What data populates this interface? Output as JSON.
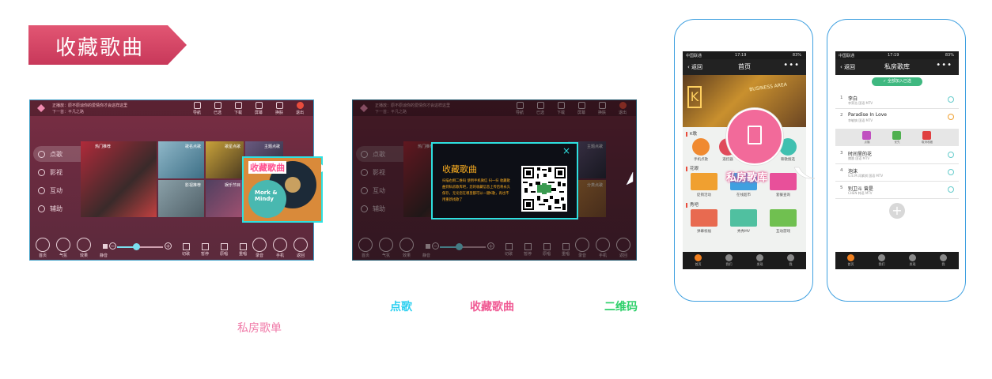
{
  "header": {
    "title": "收藏歌曲"
  },
  "tv": {
    "now_playing": "正播放：原不原谅你的爱情你才会这样这里",
    "next": "下一首：平凡之路",
    "top_icons": [
      {
        "label": "导航",
        "icon": "compass-icon"
      },
      {
        "label": "已选",
        "icon": "list-icon"
      },
      {
        "label": "下载",
        "icon": "download-icon"
      },
      {
        "label": "屏幕",
        "icon": "screen-icon"
      },
      {
        "label": "换肤",
        "icon": "skin-icon"
      },
      {
        "label": "退出",
        "icon": "power-icon"
      }
    ],
    "menu": [
      "点歌",
      "影视",
      "互动",
      "辅助"
    ],
    "tiles": [
      "热门推荐",
      "歌名点歌",
      "歌星点歌",
      "主题点歌",
      "影视推荐",
      "娱乐节目",
      "前线K歌",
      "分类点歌"
    ],
    "bottom_left": [
      "首页",
      "气氛",
      "效果"
    ],
    "volume_label": "静音",
    "volume_level": 0.42,
    "controls": [
      "切歌",
      "暂停",
      "原唱",
      "重唱"
    ],
    "bottom_right": [
      "录音",
      "手机",
      "返回"
    ]
  },
  "popover": {
    "label": "收藏歌曲",
    "card_text": "Mork & Mindy"
  },
  "dialog": {
    "title": "收藏歌曲",
    "description": "扫描右侧二维码 使用手机微信 扫一扫 收藏歌曲到私房歌库吧，您的收藏信息上传后将永久保存，无论您在哪里都可以一键K歌，再也不用重新找歌了",
    "close": "×"
  },
  "annotations": {
    "dian_ge": "点歌",
    "shou_cang": "收藏歌曲",
    "er_wei_ma": "二维码",
    "si_fang": "私房歌单"
  },
  "phone1": {
    "status": {
      "carrier": "中国联通",
      "time": "17:19",
      "battery": "83%"
    },
    "back": "返回",
    "title": "首页",
    "menu": "•••",
    "hero_text": "BUSINESS AREA",
    "section_k": "K歌",
    "k_items": [
      "手机点歌",
      "遥控器",
      "私房歌库",
      "聊歌搜选"
    ],
    "section_hua": "花眼",
    "hua_items": [
      "促销活动",
      "在线超市",
      "套餐查询"
    ],
    "section_xiu": "秀吧",
    "xiu_items": [
      "弹幕祝福",
      "秀秀MV",
      "互动游戏"
    ],
    "tabs": [
      "首页",
      "我们",
      "发现",
      "我"
    ],
    "badge_label": "私房歌库"
  },
  "phone2": {
    "status": {
      "carrier": "中国联通",
      "time": "17:19",
      "battery": "83%"
    },
    "back": "返回",
    "title": "私房歌库",
    "menu": "•••",
    "add_all": "全部加入已选",
    "songs": [
      {
        "n": "1",
        "title": "李白",
        "meta": "李荣浩   国语  MTV"
      },
      {
        "n": "2",
        "title": "Paradise In Love",
        "meta": "李敏镐   国语  MTV"
      },
      {
        "n": "3",
        "title": "时间里的花",
        "meta": "魏晨   国语  MTV"
      },
      {
        "n": "4",
        "title": "泡沫",
        "meta": "G.E.M.邓紫棋   国语  MTV"
      },
      {
        "n": "5",
        "title": "别卫斗 曾是",
        "meta": "CHEN   韩语  MTV"
      }
    ],
    "actions": [
      "点播",
      "优先",
      "取消收藏"
    ],
    "tabs": [
      "首页",
      "我们",
      "发现",
      "我"
    ]
  }
}
